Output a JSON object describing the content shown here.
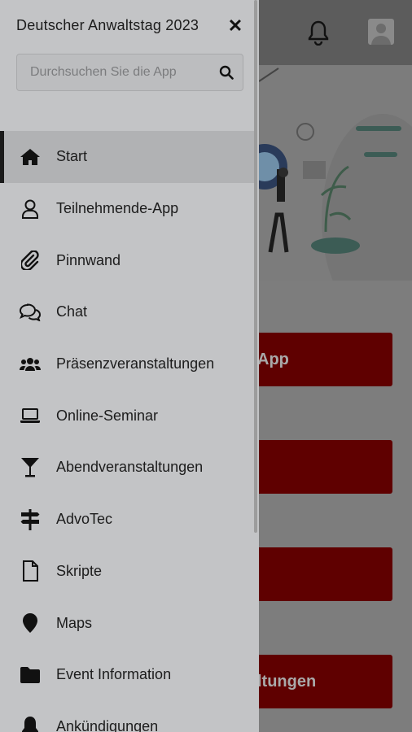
{
  "app": {
    "drawer_title": "Deutscher Anwaltstag 2023",
    "close_glyph": "✕"
  },
  "search": {
    "placeholder": "Durchsuchen Sie die App"
  },
  "menu": [
    {
      "label": "Start",
      "icon": "home-icon",
      "active": true
    },
    {
      "label": "Teilnehmende-App",
      "icon": "user-icon"
    },
    {
      "label": "Pinnwand",
      "icon": "paperclip-icon"
    },
    {
      "label": "Chat",
      "icon": "chat-icon"
    },
    {
      "label": "Präsenzveranstaltungen",
      "icon": "users-icon"
    },
    {
      "label": "Online-Seminar",
      "icon": "laptop-icon"
    },
    {
      "label": "Abendveranstaltungen",
      "icon": "cocktail-icon"
    },
    {
      "label": "AdvoTec",
      "icon": "signpost-icon"
    },
    {
      "label": "Skripte",
      "icon": "document-icon"
    },
    {
      "label": "Maps",
      "icon": "map-marker-icon"
    },
    {
      "label": "Event Information",
      "icon": "folder-icon"
    },
    {
      "label": "Ankündigungen",
      "icon": "bell-icon"
    }
  ],
  "background": {
    "buttons": [
      {
        "text": "App"
      },
      {
        "text": ""
      },
      {
        "text": ""
      },
      {
        "text": "ltungen"
      }
    ]
  },
  "colors": {
    "drawer_bg": "#c3c4c6",
    "active_bg": "#b1b2b4",
    "button_red": "#5f0000"
  }
}
